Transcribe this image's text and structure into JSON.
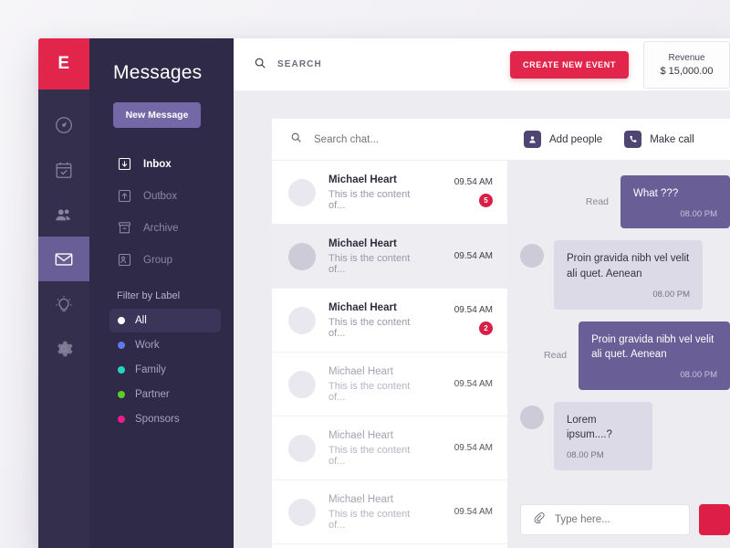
{
  "brand": {
    "logo_letter": "E",
    "logo_color": "#e2254b"
  },
  "rail": {
    "items": [
      {
        "name": "dashboard",
        "icon": "speedometer-icon",
        "active": false
      },
      {
        "name": "calendar",
        "icon": "calendar-check-icon",
        "active": false
      },
      {
        "name": "team",
        "icon": "people-icon",
        "active": false
      },
      {
        "name": "messages",
        "icon": "envelope-icon",
        "active": true
      },
      {
        "name": "ideas",
        "icon": "lightbulb-icon",
        "active": false
      },
      {
        "name": "settings",
        "icon": "gear-icon",
        "active": false
      }
    ]
  },
  "sidebar": {
    "title": "Messages",
    "new_message_label": "New Message",
    "nav": [
      {
        "label": "Inbox",
        "icon": "inbox-arrow-down-icon",
        "active": true
      },
      {
        "label": "Outbox",
        "icon": "outbox-arrow-up-icon",
        "active": false
      },
      {
        "label": "Archive",
        "icon": "archive-box-icon",
        "active": false
      },
      {
        "label": "Group",
        "icon": "group-contact-icon",
        "active": false
      }
    ],
    "filter_title": "Filter by Label",
    "labels": [
      {
        "label": "All",
        "color": "#ffffff",
        "active": true
      },
      {
        "label": "Work",
        "color": "#5b7ce8",
        "active": false
      },
      {
        "label": "Family",
        "color": "#22d6bd",
        "active": false
      },
      {
        "label": "Partner",
        "color": "#5cd021",
        "active": false
      },
      {
        "label": "Sponsors",
        "color": "#ec1d8b",
        "active": false
      }
    ]
  },
  "topbar": {
    "search_label": "SEARCH",
    "create_event_label": "CREATE NEW EVENT",
    "revenue_label": "Revenue",
    "revenue_value": "$ 15,000.00"
  },
  "chatlist": {
    "search_placeholder": "Search chat...",
    "rows": [
      {
        "name": "Michael Heart",
        "preview": "This is the content of...",
        "time": "09.54 AM",
        "badge": "5",
        "selected": false,
        "muted": false
      },
      {
        "name": "Michael Heart",
        "preview": "This is the content of...",
        "time": "09.54 AM",
        "badge": "",
        "selected": true,
        "muted": false
      },
      {
        "name": "Michael Heart",
        "preview": "This is the content of...",
        "time": "09.54 AM",
        "badge": "2",
        "selected": false,
        "muted": false
      },
      {
        "name": "Michael Heart",
        "preview": "This is the content of...",
        "time": "09.54 AM",
        "badge": "",
        "selected": false,
        "muted": true
      },
      {
        "name": "Michael Heart",
        "preview": "This is the content of...",
        "time": "09.54 AM",
        "badge": "",
        "selected": false,
        "muted": true
      },
      {
        "name": "Michael Heart",
        "preview": "This is the content of...",
        "time": "09.54 AM",
        "badge": "",
        "selected": false,
        "muted": true
      }
    ]
  },
  "conversation": {
    "add_people_label": "Add people",
    "make_call_label": "Make call",
    "read_label": "Read",
    "messages": [
      {
        "dir": "out",
        "text": "What ???",
        "time": "08.00 PM",
        "read": "Read"
      },
      {
        "dir": "in",
        "text": "Proin gravida nibh vel velit ali quet. Aenean",
        "time": "08.00 PM",
        "read": ""
      },
      {
        "dir": "out",
        "text": "Proin gravida nibh vel velit ali quet. Aenean",
        "time": "08.00 PM",
        "read": "Read"
      },
      {
        "dir": "in",
        "text": "Lorem ipsum....?",
        "time": "08.00 PM",
        "read": ""
      }
    ],
    "composer_placeholder": "Type here..."
  }
}
